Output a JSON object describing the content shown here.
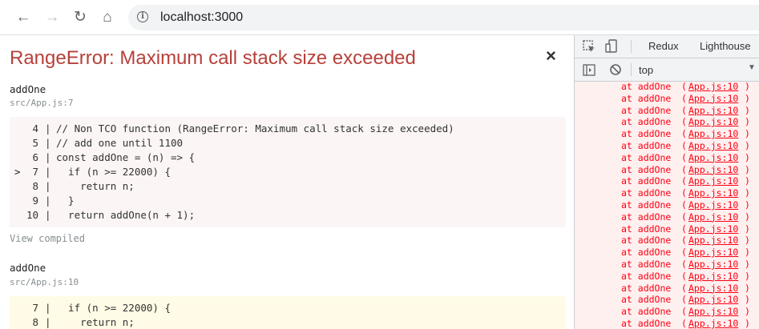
{
  "browser": {
    "url": "localhost:3000",
    "nav": {
      "back": "←",
      "forward": "→",
      "reload": "↻",
      "home": "⌂"
    }
  },
  "error": {
    "title": "RangeError: Maximum call stack size exceeded",
    "close": "×",
    "frames": [
      {
        "fn": "addOne",
        "loc": "src/App.js:7",
        "lines": [
          {
            "n": "4",
            "marker": "",
            "code": "// Non TCO function (RangeError: Maximum call stack size exceeded)"
          },
          {
            "n": "5",
            "marker": "",
            "code": "// add one until 1100"
          },
          {
            "n": "6",
            "marker": "",
            "code": "const addOne = (n) => {"
          },
          {
            "n": "7",
            "marker": ">",
            "code": "  if (n >= 22000) {"
          },
          {
            "n": "8",
            "marker": "",
            "code": "    return n;"
          },
          {
            "n": "9",
            "marker": "",
            "code": "  }"
          },
          {
            "n": "10",
            "marker": "",
            "code": "  return addOne(n + 1);"
          }
        ],
        "view_compiled": "View compiled"
      },
      {
        "fn": "addOne",
        "loc": "src/App.js:10",
        "lines": [
          {
            "n": "7",
            "marker": "",
            "code": "  if (n >= 22000) {"
          },
          {
            "n": "8",
            "marker": "",
            "code": "    return n;"
          }
        ]
      }
    ]
  },
  "devtools": {
    "tabs": [
      "Redux",
      "Lighthouse"
    ],
    "context": "top",
    "console_line": {
      "prefix": "at addOne",
      "link": "App.js:10",
      "open": "(",
      "close": ")"
    },
    "console_count": 21
  }
}
